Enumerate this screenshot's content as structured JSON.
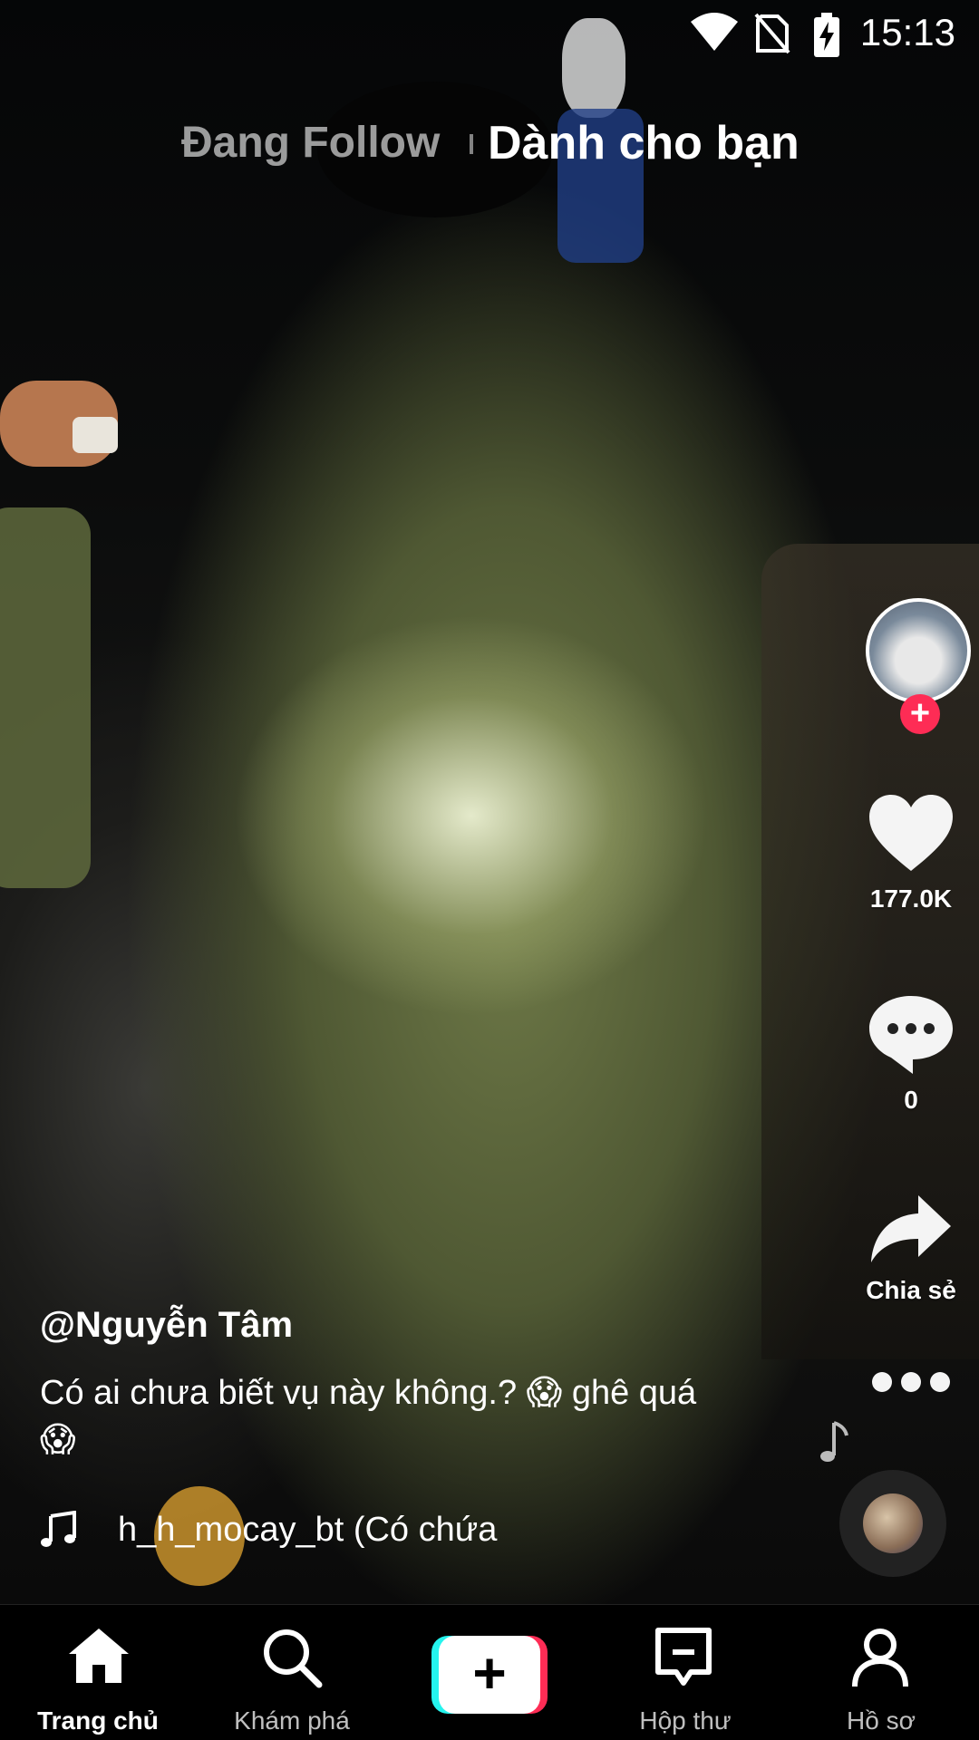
{
  "status_bar": {
    "time": "15:13",
    "icons": [
      "wifi-icon",
      "no-sim-icon",
      "battery-charging-icon"
    ]
  },
  "top_tabs": {
    "following": "Đang Follow",
    "for_you": "Dành cho bạn",
    "active": "for_you"
  },
  "actions": {
    "likes": "177.0K",
    "comments": "0",
    "share_label": "Chia sẻ"
  },
  "post": {
    "username": "@Nguyễn Tâm",
    "description": "Có ai chưa biết vụ này không.? 😱 ghê quá 😱",
    "music": "h_h_mocay_bt (Có chứa"
  },
  "nav": {
    "home": "Trang chủ",
    "discover": "Khám phá",
    "create": "+",
    "inbox": "Hộp thư",
    "profile": "Hồ sơ"
  },
  "colors": {
    "accent_red": "#fe2c55",
    "accent_cyan": "#25f4ee"
  }
}
